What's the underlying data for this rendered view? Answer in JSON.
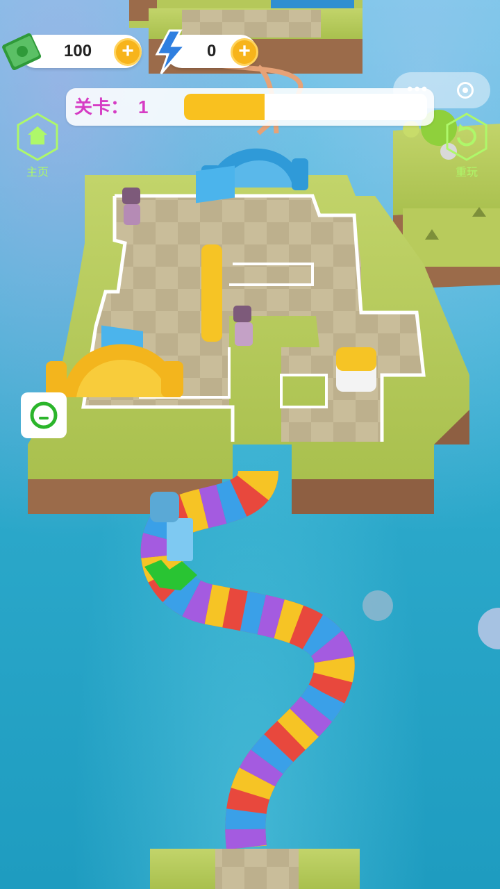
{
  "hud": {
    "money": {
      "icon": "cash-stack-icon",
      "value": "100",
      "add_label": "+"
    },
    "energy": {
      "icon": "lightning-bolt-icon",
      "value": "0",
      "add_label": "+"
    },
    "level": {
      "label": "关卡：",
      "number": "1",
      "progress": 0.33
    }
  },
  "nav": {
    "home": {
      "icon": "home-icon",
      "label": "主页"
    },
    "restart": {
      "icon": "restart-icon",
      "label": "重玩"
    },
    "capsule": {
      "menu_icon": "more-dots-icon",
      "menu_text": "•••",
      "close_icon": "target-close-icon"
    },
    "chat": {
      "icon": "chat-bubble-icon"
    }
  },
  "colors": {
    "accent_yellow": "#f9c11f",
    "level_text": "#d63cc4",
    "nav_green": "#aef86a",
    "chat_green": "#2bb52b"
  }
}
